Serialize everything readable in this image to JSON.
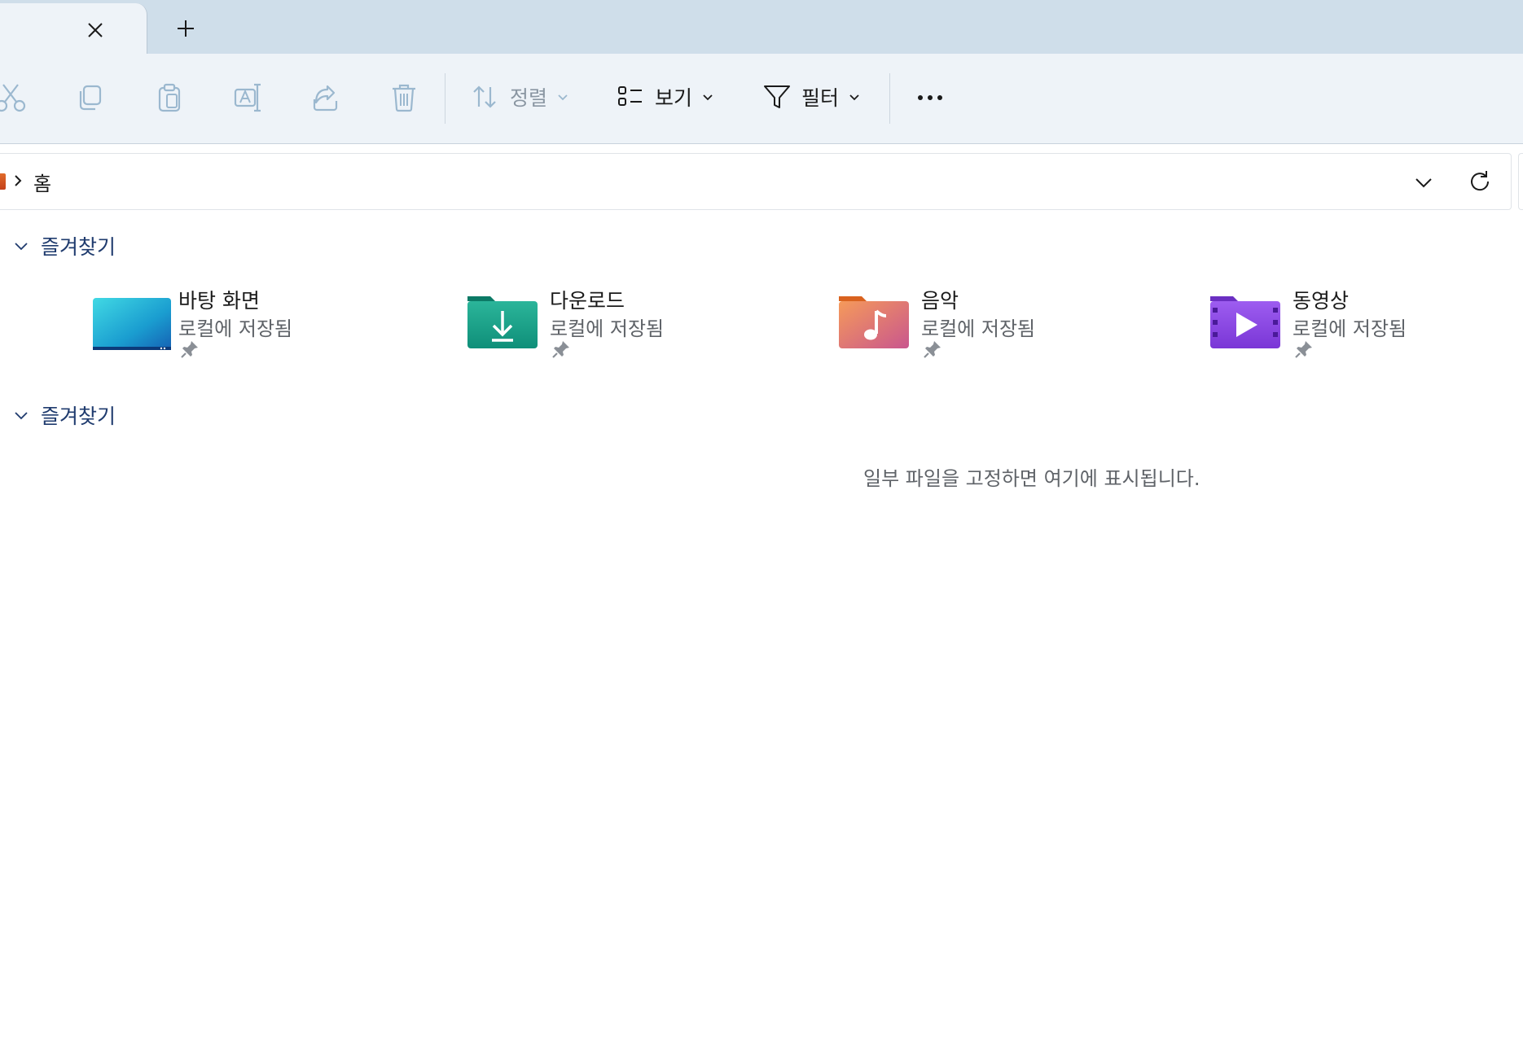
{
  "toolbar": {
    "sort_label": "정렬",
    "view_label": "보기",
    "filter_label": "필터"
  },
  "address": {
    "current": "홈"
  },
  "sections": {
    "quick_access_title": "즐겨찾기",
    "favorites_title": "즐겨찾기",
    "empty_message": "일부 파일을 고정하면 여기에 표시됩니다."
  },
  "quick_access": [
    {
      "name": "바탕 화면",
      "sub": "로컬에 저장됨",
      "icon": "desktop-folder-icon"
    },
    {
      "name": "다운로드",
      "sub": "로컬에 저장됨",
      "icon": "downloads-folder-icon"
    },
    {
      "name": "음악",
      "sub": "로컬에 저장됨",
      "icon": "music-folder-icon"
    },
    {
      "name": "동영상",
      "sub": "로컬에 저장됨",
      "icon": "videos-folder-icon"
    }
  ],
  "colors": {
    "accent": "#1f3b6e",
    "tabstrip": "#cfdeea",
    "cmdbar": "#eef3f8",
    "disabled_icon": "#9bb8cf"
  }
}
